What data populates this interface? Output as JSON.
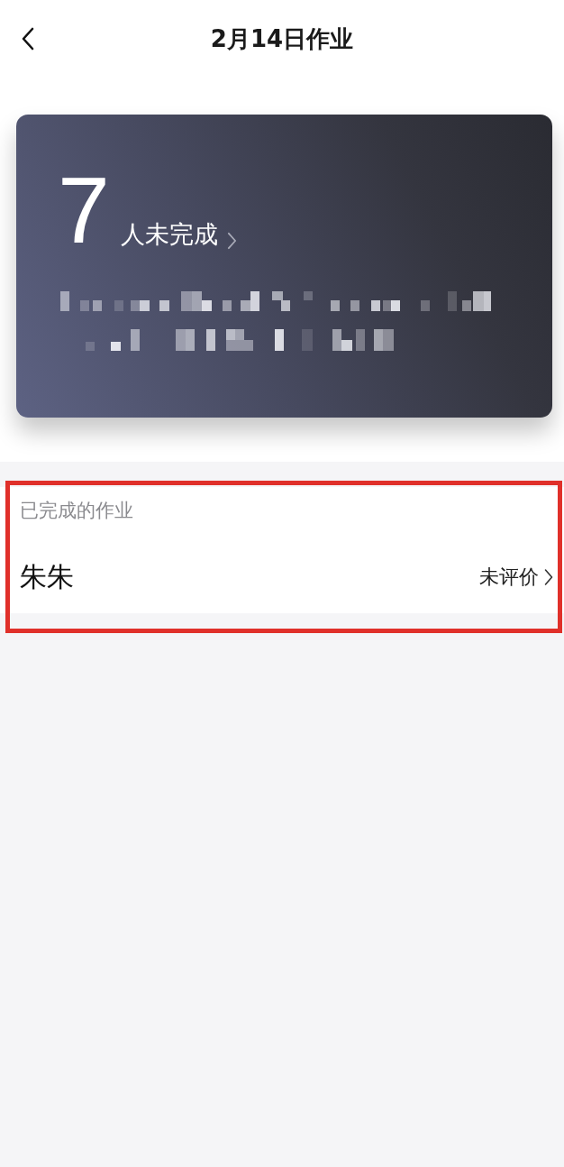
{
  "header": {
    "title": "2月14日作业"
  },
  "summary_card": {
    "count": "7",
    "label": "人未完成"
  },
  "completed_section": {
    "title": "已完成的作业",
    "highlighted": true,
    "rows": [
      {
        "name": "朱朱",
        "status": "未评价"
      }
    ]
  }
}
